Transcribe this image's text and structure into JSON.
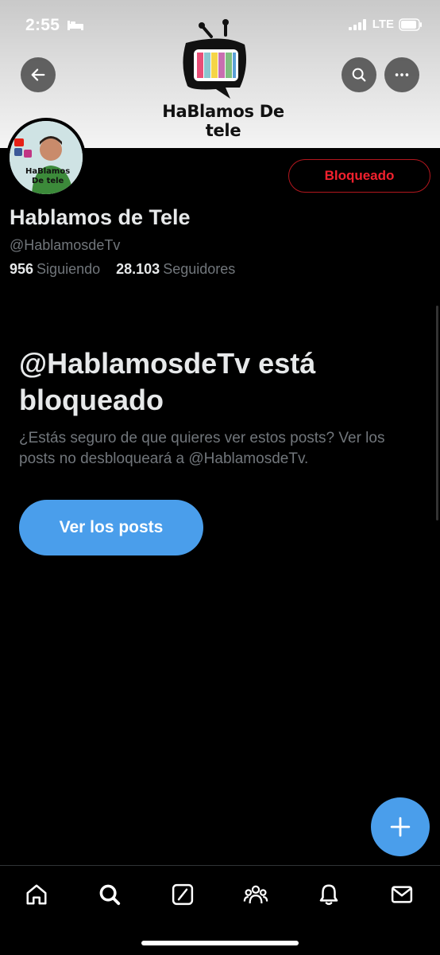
{
  "status_bar": {
    "time": "2:55",
    "network": "LTE"
  },
  "banner": {
    "logo_text": "HaBlamos De tele"
  },
  "profile": {
    "name": "Hablamos de Tele",
    "handle": "@HablamosdeTv",
    "following_count": "956",
    "following_label": "Siguiendo",
    "followers_count": "28.103",
    "followers_label": "Seguidores",
    "blocked_button_label": "Bloqueado"
  },
  "blocked_notice": {
    "title": "@HablamosdeTv está bloqueado",
    "description": "¿Estás seguro de que quieres ver estos posts? Ver los posts no desbloqueará a @HablamosdeTv.",
    "button_label": "Ver los posts"
  },
  "colors": {
    "accent": "#4a9eeb",
    "danger": "#f4212e",
    "muted": "#71767b",
    "text": "#e7e9ea"
  },
  "icons": [
    "back-arrow-icon",
    "search-icon",
    "more-icon",
    "compose-icon",
    "home-icon",
    "explore-icon",
    "grok-icon",
    "communities-icon",
    "notifications-icon",
    "messages-icon"
  ]
}
